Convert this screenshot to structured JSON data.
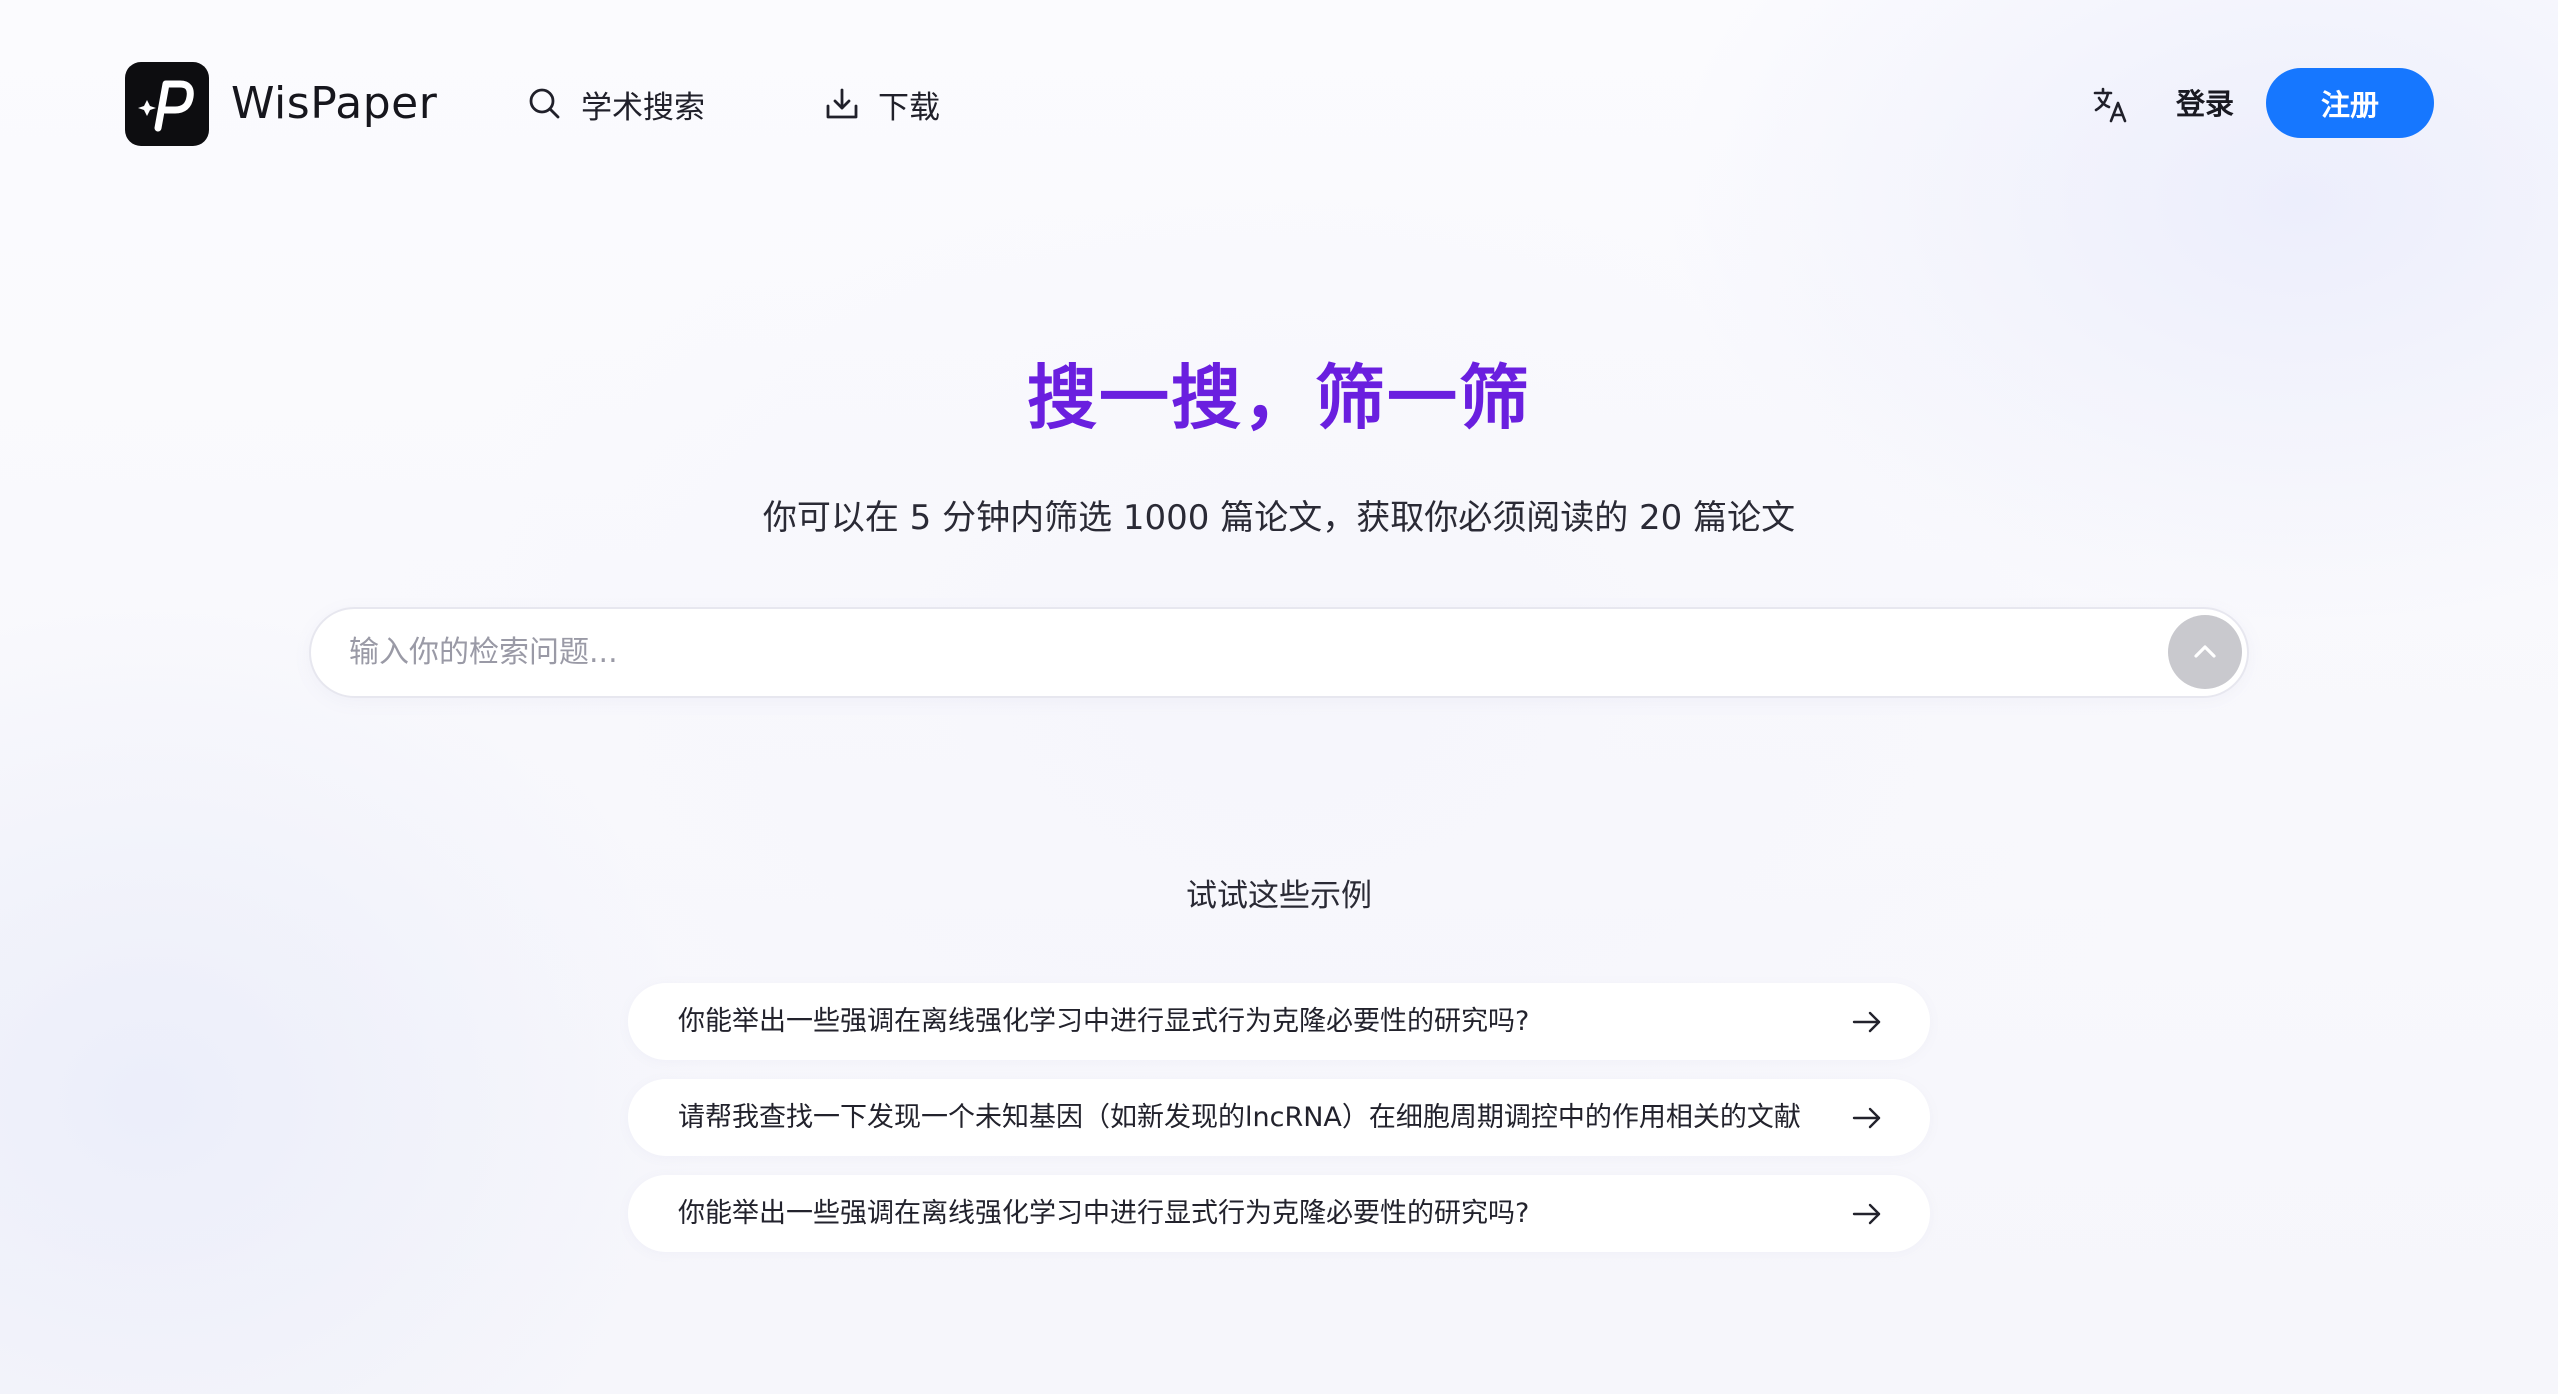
{
  "header": {
    "brand": "WisPaper",
    "nav": [
      {
        "label": "学术搜索",
        "icon": "search-icon"
      },
      {
        "label": "下载",
        "icon": "download-icon"
      }
    ],
    "translate_icon": "translate-icon",
    "login_label": "登录",
    "register_label": "注册",
    "accent_color": "#1677ff"
  },
  "hero": {
    "title": "搜一搜，筛一筛",
    "title_color": "#6a1fdf",
    "subtitle": "你可以在 5 分钟内筛选 1000 篇论文，获取你必须阅读的 20 篇论文"
  },
  "search": {
    "placeholder": "输入你的检索问题...",
    "value": "",
    "submit_icon": "chevron-up-icon"
  },
  "examples": {
    "heading": "试试这些示例",
    "items": [
      {
        "text": "你能举出一些强调在离线强化学习中进行显式行为克隆必要性的研究吗?"
      },
      {
        "text": "请帮我查找一下发现一个未知基因（如新发现的lncRNA）在细胞周期调控中的作用相关的文献"
      },
      {
        "text": "你能举出一些强调在离线强化学习中进行显式行为克隆必要性的研究吗?"
      }
    ]
  }
}
